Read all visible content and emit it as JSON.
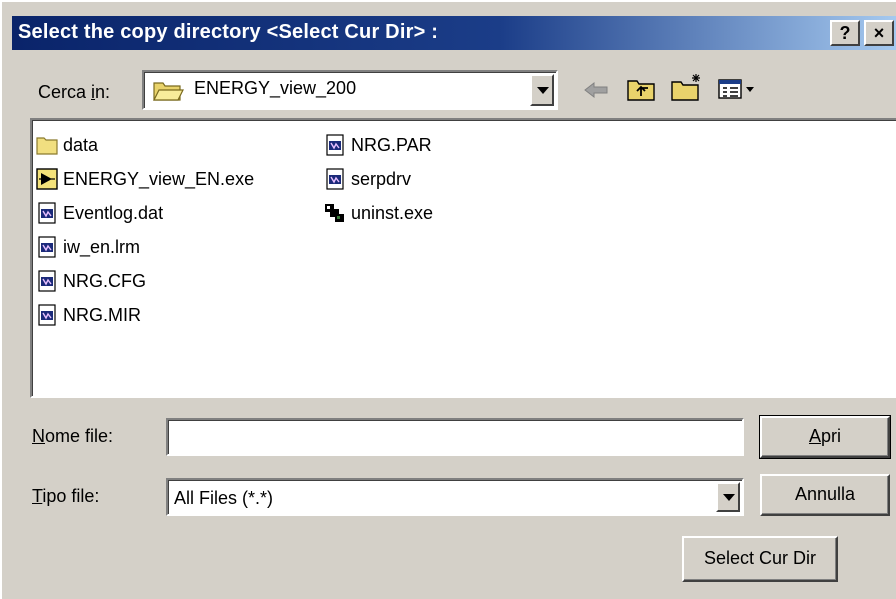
{
  "dialog": {
    "title": "Select the copy directory <Select Cur Dir> :",
    "help_label": "?",
    "close_label": "×"
  },
  "look_in": {
    "label_prefix": "Cerca ",
    "label_underlined": "i",
    "label_suffix": "n:",
    "value": "ENERGY_view_200"
  },
  "toolbar": {
    "icons": [
      "back-arrow-icon",
      "up-folder-icon",
      "new-folder-icon",
      "view-menu-icon"
    ]
  },
  "files": [
    {
      "name": "data",
      "icon": "folder-icon"
    },
    {
      "name": "ENERGY_view_EN.exe",
      "icon": "labview-exe-icon"
    },
    {
      "name": "Eventlog.dat",
      "icon": "generic-file-icon"
    },
    {
      "name": "iw_en.lrm",
      "icon": "generic-file-icon"
    },
    {
      "name": "NRG.CFG",
      "icon": "generic-file-icon"
    },
    {
      "name": "NRG.MIR",
      "icon": "generic-file-icon"
    },
    {
      "name": "NRG.PAR",
      "icon": "generic-file-icon"
    },
    {
      "name": "serpdrv",
      "icon": "generic-file-icon"
    },
    {
      "name": "uninst.exe",
      "icon": "uninstall-exe-icon"
    }
  ],
  "filename": {
    "label_underlined": "N",
    "label_rest": "ome file:",
    "value": ""
  },
  "filetype": {
    "label_underlined": "T",
    "label_rest": "ipo file:",
    "value": "All Files (*.*)"
  },
  "buttons": {
    "open_underlined": "A",
    "open_rest": "pri",
    "cancel": "Annulla",
    "select_cur_dir": "Select Cur Dir"
  },
  "colors": {
    "titlebar_start": "#0a246a",
    "titlebar_end": "#a6caf0",
    "face": "#d4d0c8"
  }
}
